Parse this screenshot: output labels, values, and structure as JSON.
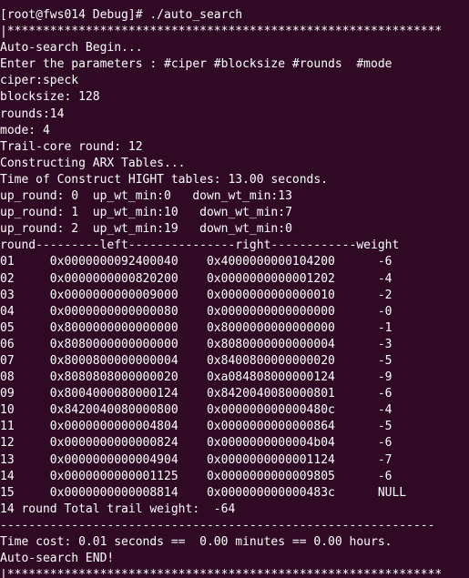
{
  "terminal": {
    "background": "#300a24",
    "foreground": "#ffffff",
    "lines": [
      "[root@fws014 Debug]# ./auto_search",
      "|*************************************************************",
      "Auto-search Begin...",
      "Enter the parameters : #ciper #blocksize #rounds  #mode",
      "ciper:speck",
      "blocksize: 128",
      "rounds:14",
      "mode: 4",
      "Trail-core round: 12",
      "Constructing ARX Tables...",
      "Time of Construct HIGHT tables: 13.00 seconds.",
      "up_round: 0  up_wt_min:0   down_wt_min:13",
      "up_round: 1  up_wt_min:10   down_wt_min:7",
      "up_round: 2  up_wt_min:19   down_wt_min:0",
      "round---------left---------------right------------weight",
      "01     0x0000000092400040    0x4000000000104200      -6",
      "02     0x0000000000820200    0x0000000000001202      -4",
      "03     0x0000000000009000    0x0000000000000010      -2",
      "04     0x0000000000000080    0x0000000000000000      -0",
      "05     0x8000000000000000    0x8000000000000000      -1",
      "06     0x8080000000000000    0x8080000000000004      -3",
      "07     0x8000800000000004    0x8400800000000020      -5",
      "08     0x8080808000000020    0xa084808000000124      -9",
      "09     0x8004000080000124    0x8420040080000801      -6",
      "10     0x8420040080000800    0x000000000000480c      -4",
      "11     0x0000000000004804    0x0000000000000864      -5",
      "12     0x0000000000000824    0x0000000000004b04      -6",
      "13     0x0000000000004904    0x0000000000001124      -7",
      "14     0x0000000000001125    0x0000000000009805      -6",
      "15     0x0000000000008814    0x000000000000483c      NULL",
      "14 round Total trail weight:  -64",
      "-------------------------------------------------------------",
      "Time cost: 0.01 seconds ==  0.00 minutes == 0.00 hours.",
      "Auto-search END!",
      "|*************************************************************"
    ]
  }
}
